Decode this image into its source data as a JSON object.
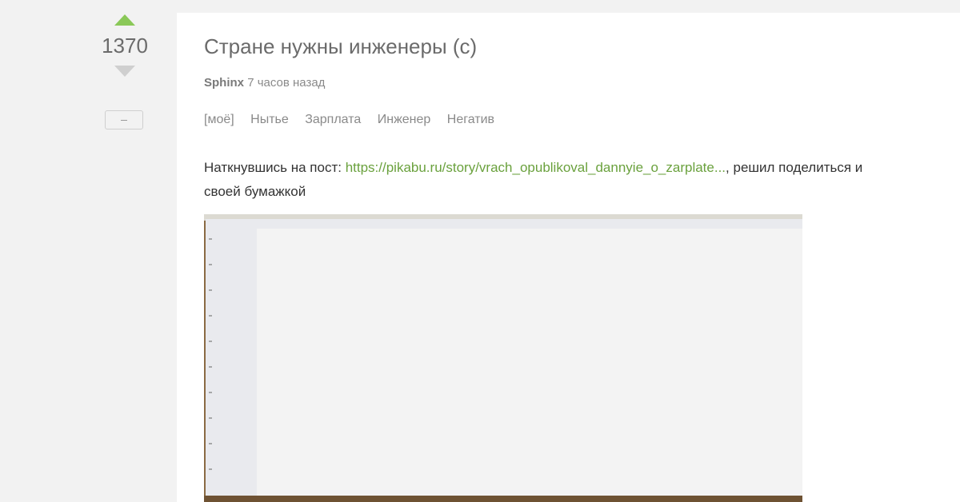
{
  "vote": {
    "rating": "1370",
    "collapse_label": "–"
  },
  "story": {
    "title": "Стране нужны инженеры (с)",
    "author": "Sphinx",
    "time": "7 часов назад",
    "tags": [
      "[моё]",
      "Нытье",
      "Зарплата",
      "Инженер",
      "Негатив"
    ],
    "text_before": "Наткнувшись на пост: ",
    "link": "https://pikabu.ru/story/vrach_opublikoval_dannyie_o_zarplate...",
    "text_after": ", решил поделиться и своей бумажкой"
  },
  "colors": {
    "upvote": "#8ac858",
    "downvote": "#cfcfcf",
    "link": "#6aa13d"
  }
}
